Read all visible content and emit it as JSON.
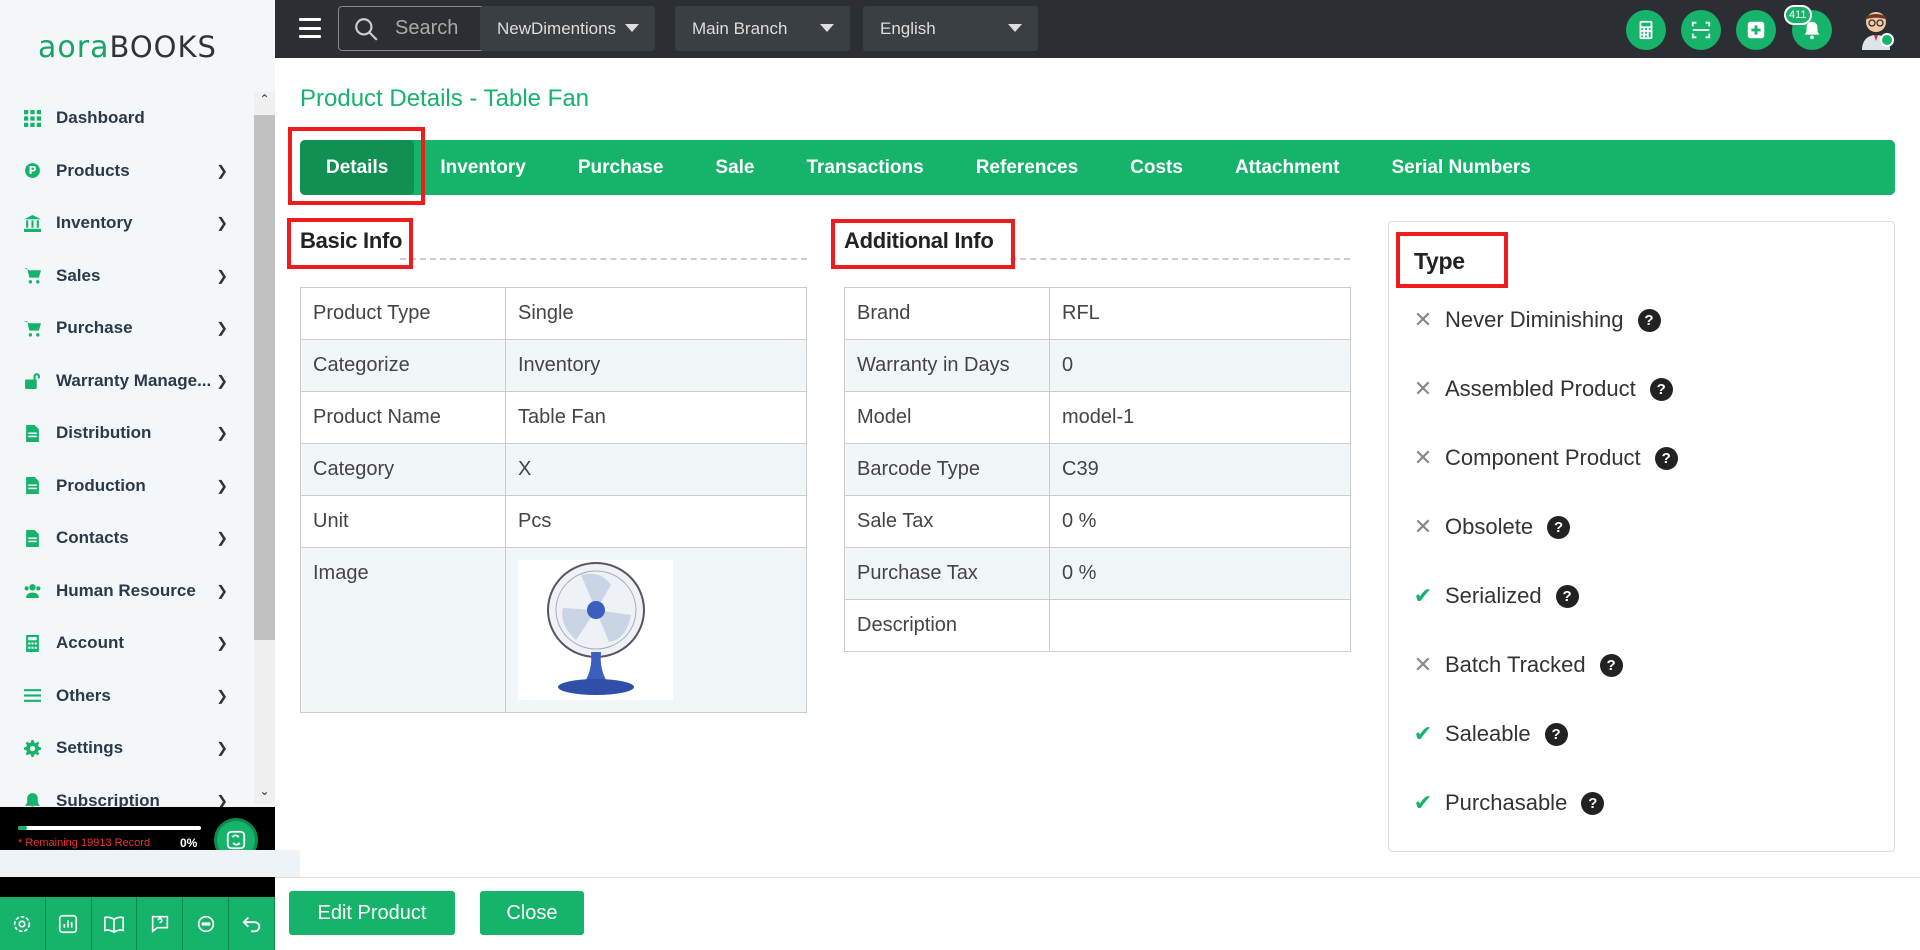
{
  "logo": {
    "part1": "aora",
    "part2": "BOOKS"
  },
  "sidebar": {
    "items": [
      {
        "label": "Dashboard",
        "icon": "grid-icon",
        "chevron": false
      },
      {
        "label": "Products",
        "icon": "product-icon",
        "chevron": true
      },
      {
        "label": "Inventory",
        "icon": "bank-icon",
        "chevron": true
      },
      {
        "label": "Sales",
        "icon": "cart-icon",
        "chevron": true
      },
      {
        "label": "Purchase",
        "icon": "cart-icon",
        "chevron": true
      },
      {
        "label": "Warranty Manage...",
        "icon": "unlock-icon",
        "chevron": true
      },
      {
        "label": "Distribution",
        "icon": "document-icon",
        "chevron": true
      },
      {
        "label": "Production",
        "icon": "document-icon",
        "chevron": true
      },
      {
        "label": "Contacts",
        "icon": "document-icon",
        "chevron": true
      },
      {
        "label": "Human Resource",
        "icon": "users-icon",
        "chevron": true
      },
      {
        "label": "Account",
        "icon": "calculator-icon",
        "chevron": true
      },
      {
        "label": "Others",
        "icon": "list-icon",
        "chevron": true
      },
      {
        "label": "Settings",
        "icon": "gear-icon",
        "chevron": true
      },
      {
        "label": "Subscription",
        "icon": "bell-icon",
        "chevron": true
      }
    ],
    "progress": {
      "text": "* Remaining 19913 Record",
      "percent": "0%",
      "fraction": 0.05
    }
  },
  "topbar": {
    "search_placeholder": "Search",
    "company": "NewDimentions",
    "branch": "Main Branch",
    "language": "English",
    "notification_count": "411"
  },
  "page": {
    "title": "Product Details - Table Fan",
    "tabs": [
      "Details",
      "Inventory",
      "Purchase",
      "Sale",
      "Transactions",
      "References",
      "Costs",
      "Attachment",
      "Serial Numbers"
    ],
    "active_tab": "Details"
  },
  "basic_info": {
    "title": "Basic Info",
    "rows": [
      {
        "label": "Product Type",
        "value": "Single"
      },
      {
        "label": "Categorize",
        "value": "Inventory"
      },
      {
        "label": "Product Name",
        "value": "Table Fan"
      },
      {
        "label": "Category",
        "value": "X"
      },
      {
        "label": "Unit",
        "value": "Pcs"
      },
      {
        "label": "Image",
        "value": ""
      }
    ]
  },
  "additional_info": {
    "title": "Additional Info",
    "rows": [
      {
        "label": "Brand",
        "value": "RFL"
      },
      {
        "label": "Warranty in Days",
        "value": "0"
      },
      {
        "label": "Model",
        "value": "model-1"
      },
      {
        "label": "Barcode Type",
        "value": "C39"
      },
      {
        "label": "Sale Tax",
        "value": "0 %"
      },
      {
        "label": "Purchase Tax",
        "value": "0 %"
      },
      {
        "label": "Description",
        "value": ""
      }
    ]
  },
  "type": {
    "title": "Type",
    "items": [
      {
        "label": "Never Diminishing",
        "checked": false
      },
      {
        "label": "Assembled Product",
        "checked": false
      },
      {
        "label": "Component Product",
        "checked": false
      },
      {
        "label": "Obsolete",
        "checked": false
      },
      {
        "label": "Serialized",
        "checked": true
      },
      {
        "label": "Batch Tracked",
        "checked": false
      },
      {
        "label": "Saleable",
        "checked": true
      },
      {
        "label": "Purchasable",
        "checked": true
      }
    ]
  },
  "footer": {
    "edit_label": "Edit Product",
    "close_label": "Close"
  },
  "colors": {
    "brand": "#16b36b",
    "highlight": "#ee1c1c",
    "topbar": "#2b2f33"
  }
}
